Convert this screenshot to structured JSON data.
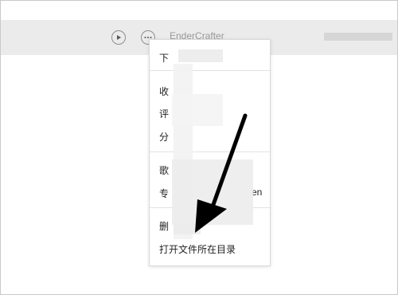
{
  "track": {
    "title": "EnderCrafter",
    "play_icon": "play-icon",
    "more_icon": "more-options-icon"
  },
  "context_menu": {
    "download": "下",
    "favorite": "收",
    "comment": "评",
    "share": "分",
    "song": "歌",
    "album": "专",
    "album_tail": "en",
    "delete": "删",
    "open_folder": "打开文件所在目录"
  },
  "annotation": {
    "arrow_color": "#000000",
    "arrow_icon": "arrow-down-left-icon"
  },
  "colors": {
    "row_bg": "#ebebeb",
    "menu_bg": "#ffffff",
    "separator": "#e2e2e2",
    "redaction": "#ececec"
  }
}
